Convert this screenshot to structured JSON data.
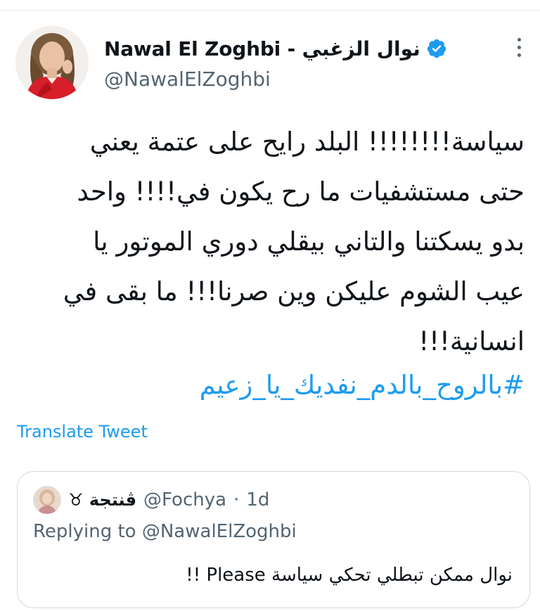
{
  "tweet": {
    "author": {
      "display_name": "Nawal El Zoghbi - نوال الزغبي",
      "handle": "@NawalElZoghbi",
      "verified": true,
      "avatar_icon": "profile-photo"
    },
    "body_lines": [
      "سياسة!!!!!!!! البلد رايح على عتمة يعني",
      "حتى مستشفيات ما رح يكون في!!!! واحد",
      "بدو يسكتنا والتاني بيقلي دوري الموتور يا",
      "عيب الشوم عليكن وين صرنا!!! ما بقى في",
      "انسانية!!!"
    ],
    "hashtag": "#بالروح_بالدم_نفديك_يا_زعيم",
    "translate_label": "Translate Tweet",
    "more_icon": "more-vertical-icon"
  },
  "quoted_tweet": {
    "display_name": "ڤنتجة ♉",
    "handle": "@Fochya",
    "separator": "·",
    "time": "1d",
    "replying_prefix": "Replying to",
    "replying_to": "@NawalElZoghbi",
    "text": "نوال ممكن تبطلي تحكي سياسة Please !!"
  },
  "colors": {
    "accent": "#1d9bf0",
    "secondary_text": "#536471",
    "primary_text": "#0f1419",
    "border": "#cfd9de"
  }
}
